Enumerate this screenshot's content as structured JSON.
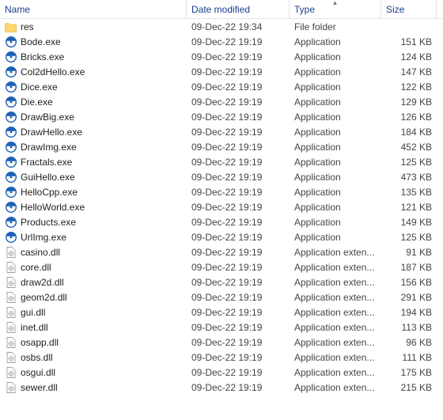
{
  "columns": {
    "name": "Name",
    "date": "Date modified",
    "type": "Type",
    "size": "Size",
    "sorted_column": "type",
    "sort_direction": "asc"
  },
  "type_labels": {
    "folder": "File folder",
    "exe": "Application",
    "dll": "Application exten..."
  },
  "size_suffix": "KB",
  "rows": [
    {
      "icon": "folder",
      "name": "res",
      "date": "09-Dec-22 19:34",
      "type": "folder",
      "size": ""
    },
    {
      "icon": "exe",
      "name": "Bode.exe",
      "date": "09-Dec-22 19:19",
      "type": "exe",
      "size": "151"
    },
    {
      "icon": "exe",
      "name": "Bricks.exe",
      "date": "09-Dec-22 19:19",
      "type": "exe",
      "size": "124"
    },
    {
      "icon": "exe",
      "name": "Col2dHello.exe",
      "date": "09-Dec-22 19:19",
      "type": "exe",
      "size": "147"
    },
    {
      "icon": "exe",
      "name": "Dice.exe",
      "date": "09-Dec-22 19:19",
      "type": "exe",
      "size": "122"
    },
    {
      "icon": "exe",
      "name": "Die.exe",
      "date": "09-Dec-22 19:19",
      "type": "exe",
      "size": "129"
    },
    {
      "icon": "exe",
      "name": "DrawBig.exe",
      "date": "09-Dec-22 19:19",
      "type": "exe",
      "size": "126"
    },
    {
      "icon": "exe",
      "name": "DrawHello.exe",
      "date": "09-Dec-22 19:19",
      "type": "exe",
      "size": "184"
    },
    {
      "icon": "exe",
      "name": "DrawImg.exe",
      "date": "09-Dec-22 19:19",
      "type": "exe",
      "size": "452"
    },
    {
      "icon": "exe",
      "name": "Fractals.exe",
      "date": "09-Dec-22 19:19",
      "type": "exe",
      "size": "125"
    },
    {
      "icon": "exe",
      "name": "GuiHello.exe",
      "date": "09-Dec-22 19:19",
      "type": "exe",
      "size": "473"
    },
    {
      "icon": "exe",
      "name": "HelloCpp.exe",
      "date": "09-Dec-22 19:19",
      "type": "exe",
      "size": "135"
    },
    {
      "icon": "exe",
      "name": "HelloWorld.exe",
      "date": "09-Dec-22 19:19",
      "type": "exe",
      "size": "121"
    },
    {
      "icon": "exe",
      "name": "Products.exe",
      "date": "09-Dec-22 19:19",
      "type": "exe",
      "size": "149"
    },
    {
      "icon": "exe",
      "name": "UrlImg.exe",
      "date": "09-Dec-22 19:19",
      "type": "exe",
      "size": "125"
    },
    {
      "icon": "dll",
      "name": "casino.dll",
      "date": "09-Dec-22 19:19",
      "type": "dll",
      "size": "91"
    },
    {
      "icon": "dll",
      "name": "core.dll",
      "date": "09-Dec-22 19:19",
      "type": "dll",
      "size": "187"
    },
    {
      "icon": "dll",
      "name": "draw2d.dll",
      "date": "09-Dec-22 19:19",
      "type": "dll",
      "size": "156"
    },
    {
      "icon": "dll",
      "name": "geom2d.dll",
      "date": "09-Dec-22 19:19",
      "type": "dll",
      "size": "291"
    },
    {
      "icon": "dll",
      "name": "gui.dll",
      "date": "09-Dec-22 19:19",
      "type": "dll",
      "size": "194"
    },
    {
      "icon": "dll",
      "name": "inet.dll",
      "date": "09-Dec-22 19:19",
      "type": "dll",
      "size": "113"
    },
    {
      "icon": "dll",
      "name": "osapp.dll",
      "date": "09-Dec-22 19:19",
      "type": "dll",
      "size": "96"
    },
    {
      "icon": "dll",
      "name": "osbs.dll",
      "date": "09-Dec-22 19:19",
      "type": "dll",
      "size": "111"
    },
    {
      "icon": "dll",
      "name": "osgui.dll",
      "date": "09-Dec-22 19:19",
      "type": "dll",
      "size": "175"
    },
    {
      "icon": "dll",
      "name": "sewer.dll",
      "date": "09-Dec-22 19:19",
      "type": "dll",
      "size": "215"
    }
  ]
}
